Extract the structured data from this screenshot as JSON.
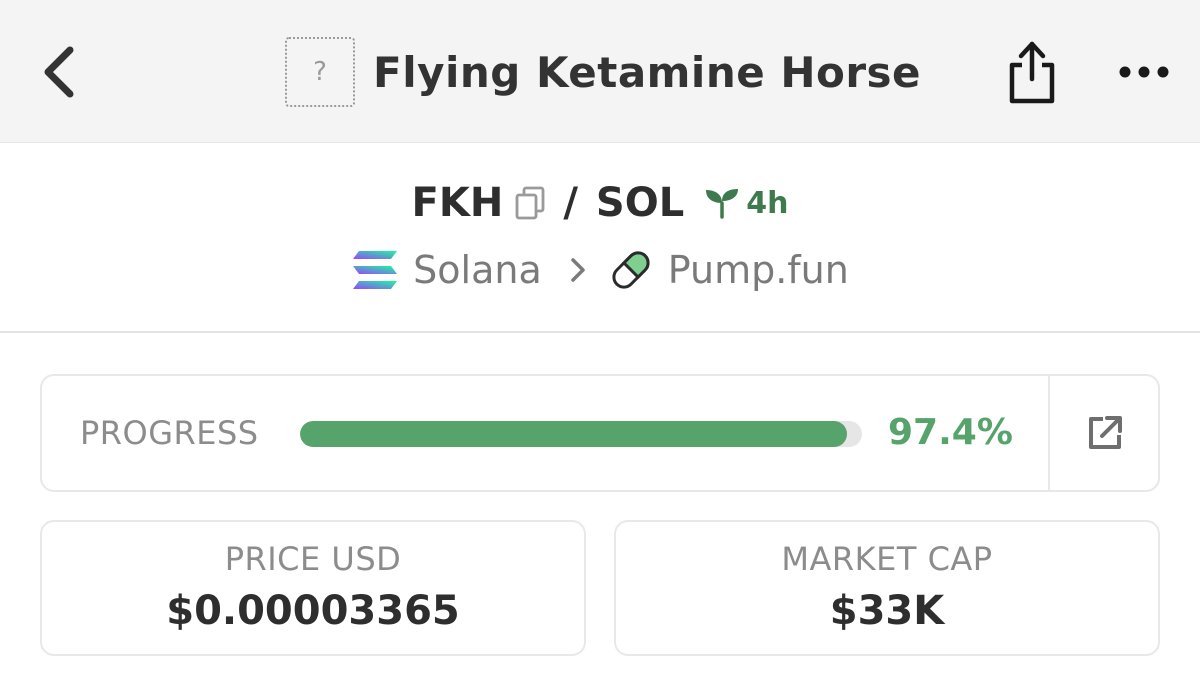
{
  "header": {
    "back_icon": "chevron-left-icon",
    "token_image_placeholder": "?",
    "title": "Flying Ketamine Horse",
    "share_icon": "share-icon",
    "more_icon": "more-horizontal-icon"
  },
  "pair": {
    "base": "FKH",
    "separator": "/",
    "quote": "SOL",
    "copy_icon": "copy-icon",
    "age_icon": "sprout-icon",
    "age": "4h",
    "age_color": "#3e7a4e"
  },
  "chain": {
    "name": "Solana",
    "icon": "solana-icon",
    "separator_icon": "chevron-right-icon",
    "dex": "Pump.fun",
    "dex_icon": "pill-icon"
  },
  "progress": {
    "label": "PROGRESS",
    "value_text": "97.4%",
    "value": 97.4,
    "color": "#57a36c",
    "external_icon": "external-link-icon"
  },
  "stats": {
    "price": {
      "label": "PRICE USD",
      "value": "$0.00003365"
    },
    "market_cap": {
      "label": "MARKET CAP",
      "value": "$33K"
    }
  }
}
